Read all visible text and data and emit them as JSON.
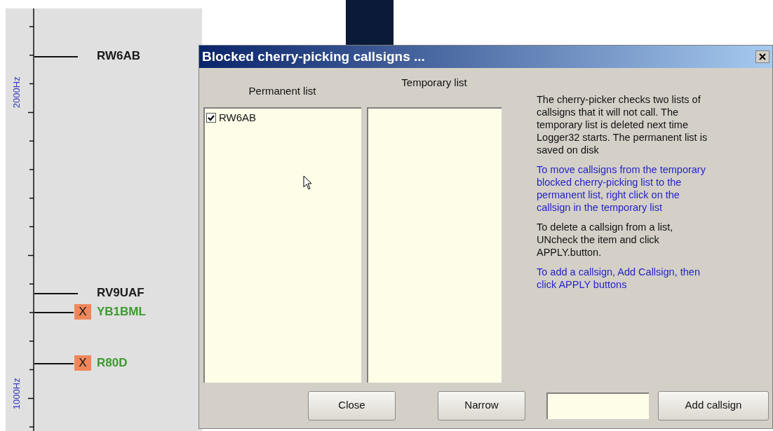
{
  "spectrum": {
    "axis_labels": [
      {
        "text": "2000Hz"
      },
      {
        "text": "1000Hz"
      }
    ],
    "stations": [
      {
        "callsign": "RW6AB",
        "color": "#1a1a1a"
      },
      {
        "callsign": "RV9UAF",
        "color": "#1a1a1a"
      },
      {
        "callsign": "YB1BML",
        "color": "#3c9a2e",
        "badge": "X"
      },
      {
        "callsign": "R80D",
        "color": "#3c9a2e",
        "badge": "X"
      }
    ]
  },
  "dialog": {
    "title": "Blocked cherry-picking callsigns ...",
    "permanent_list": {
      "header": "Permanent list",
      "items": [
        {
          "label": "RW6AB",
          "checked": true
        }
      ]
    },
    "temporary_list": {
      "header": "Temporary list"
    },
    "paragraphs": [
      {
        "text": "The cherry-picker checks two lists of callsigns that it will not call. The temporary list is deleted next time Logger32 starts.  The permanent list is saved on disk",
        "color": "#111111"
      },
      {
        "text": "To move callsigns from the temporary blocked cherry-picking list to the permanent list, right click on the callsign in the temporary list",
        "color": "#2424c8"
      },
      {
        "text": "To delete a callsign from a list, UNcheck the item and click APPLY.button.",
        "color": "#111111"
      },
      {
        "text": "To add a callsign, Add Callsign, then click APPLY buttons",
        "color": "#2424c8"
      }
    ],
    "buttons": [
      {
        "label": "Close"
      },
      {
        "label": "Narrow"
      }
    ],
    "add_button": {
      "label": "Add callsign"
    }
  }
}
